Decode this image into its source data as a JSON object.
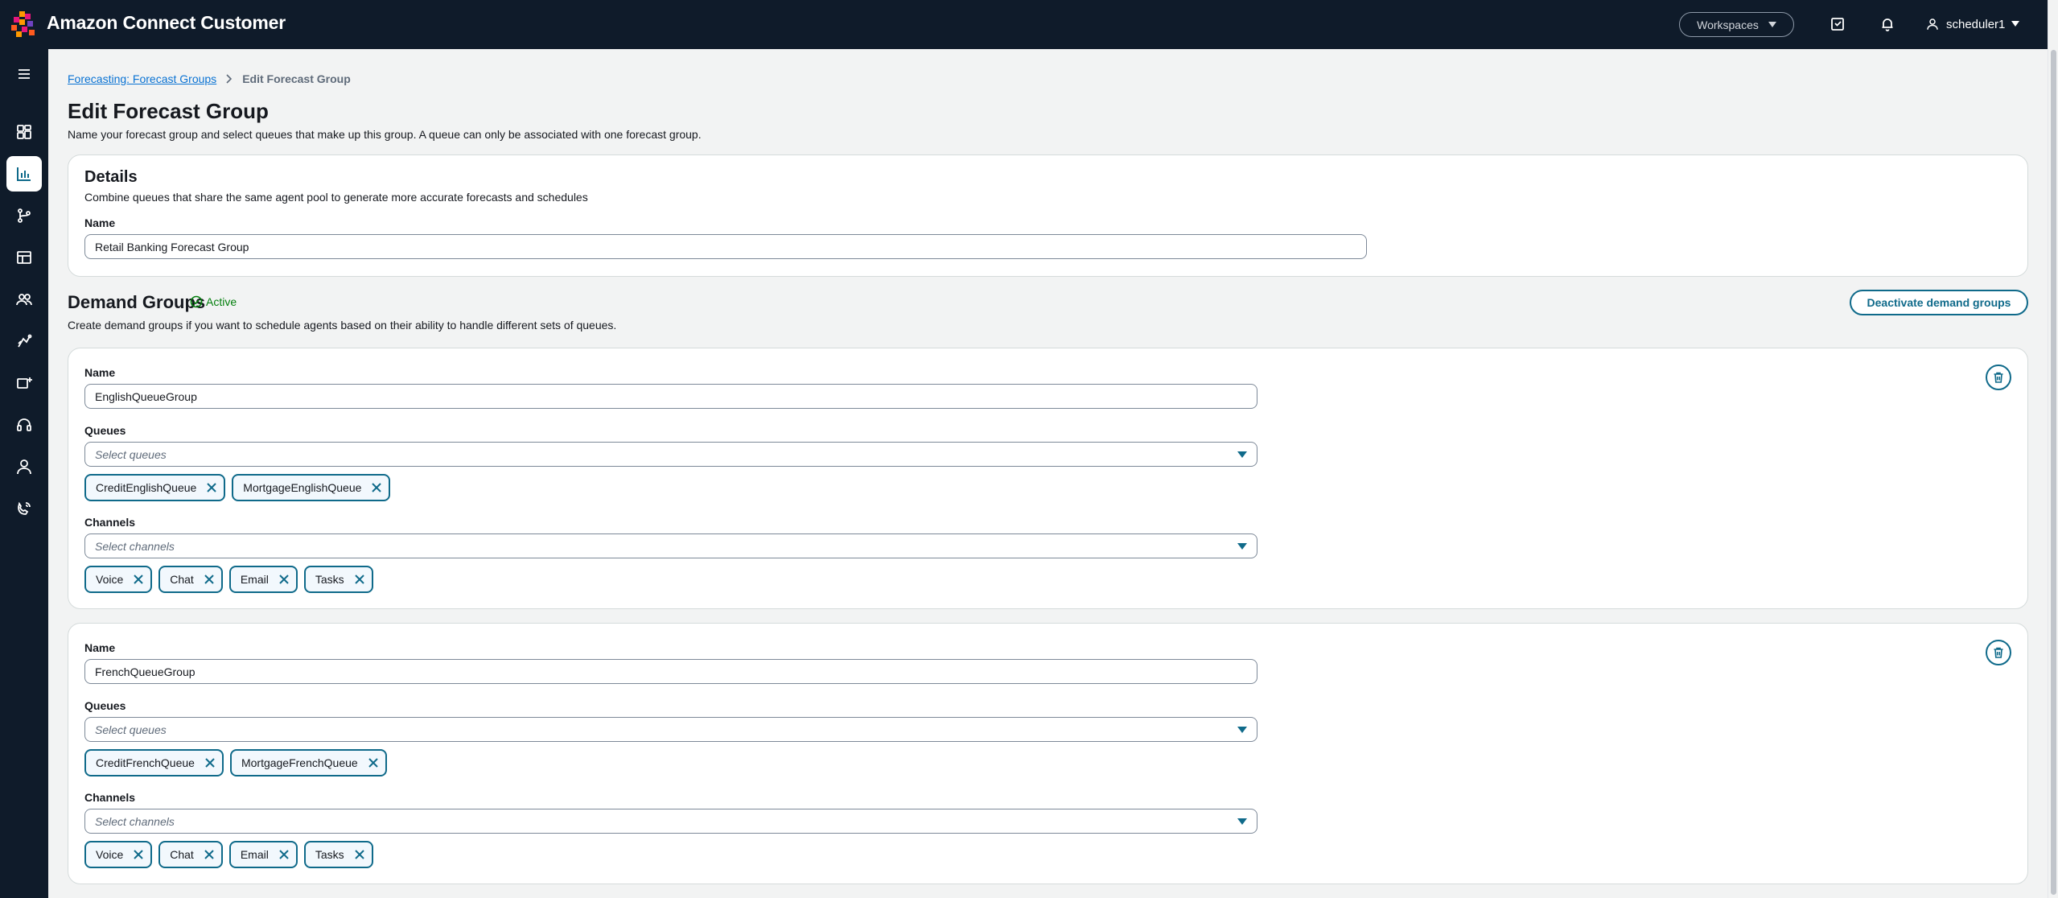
{
  "app": {
    "title": "Amazon Connect Customer"
  },
  "topbar": {
    "workspaces_label": "Workspaces",
    "user_name": "scheduler1"
  },
  "breadcrumb": {
    "parent": "Forecasting: Forecast Groups",
    "current": "Edit Forecast Group"
  },
  "page": {
    "title": "Edit Forecast Group",
    "description": "Name your forecast group and select queues that make up this group. A queue can only be associated with one forecast group."
  },
  "details": {
    "title": "Details",
    "description": "Combine queues that share the same agent pool to generate more accurate forecasts and schedules",
    "name_label": "Name",
    "name_value": "Retail Banking Forecast Group"
  },
  "demand_groups": {
    "title": "Demand Groups",
    "status": "Active",
    "description": "Create demand groups if you want to schedule agents based on their ability to handle different sets of queues.",
    "deactivate_label": "Deactivate demand groups",
    "groups": [
      {
        "name_label": "Name",
        "name_value": "EnglishQueueGroup",
        "queues_label": "Queues",
        "queues_placeholder": "Select queues",
        "queues": [
          "CreditEnglishQueue",
          "MortgageEnglishQueue"
        ],
        "channels_label": "Channels",
        "channels_placeholder": "Select channels",
        "channels": [
          "Voice",
          "Chat",
          "Email",
          "Tasks"
        ]
      },
      {
        "name_label": "Name",
        "name_value": "FrenchQueueGroup",
        "queues_label": "Queues",
        "queues_placeholder": "Select queues",
        "queues": [
          "CreditFrenchQueue",
          "MortgageFrenchQueue"
        ],
        "channels_label": "Channels",
        "channels_placeholder": "Select channels",
        "channels": [
          "Voice",
          "Chat",
          "Email",
          "Tasks"
        ]
      }
    ]
  },
  "nav_icons": [
    "menu-icon",
    "dashboard-icon",
    "analytics-icon",
    "routing-icon",
    "table-icon",
    "users-icon",
    "channels-icon",
    "integrations-icon",
    "headset-icon",
    "profile-icon",
    "campaigns-icon"
  ],
  "colors": {
    "topbar_bg": "#0f1b2a",
    "accent": "#0f6a8a",
    "link": "#0972d3",
    "success": "#037f0c"
  }
}
